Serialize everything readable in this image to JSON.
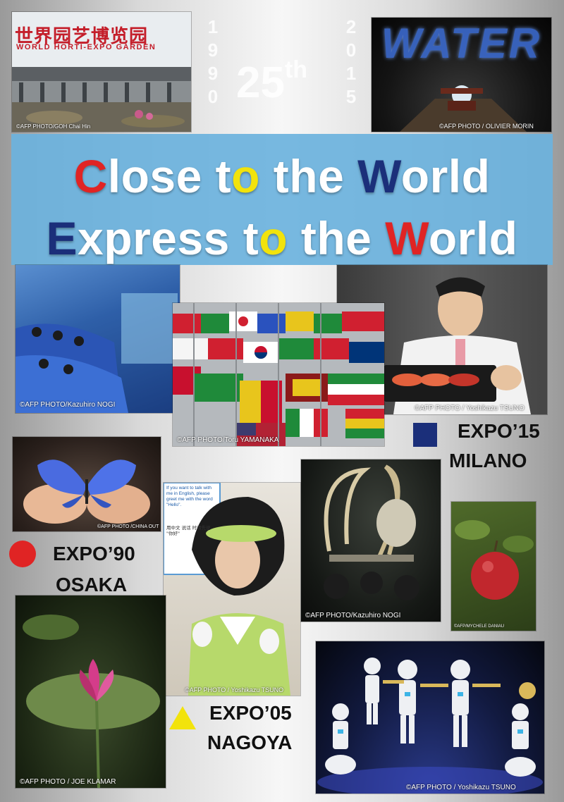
{
  "years": {
    "left": [
      "1",
      "9",
      "9",
      "0"
    ],
    "right": [
      "2",
      "0",
      "1",
      "5"
    ],
    "anniversary_number": "25",
    "anniversary_suffix": "th"
  },
  "headline": {
    "line1": [
      {
        "text": "C",
        "color": "#e02424"
      },
      {
        "text": "lose t",
        "color": "#ffffff"
      },
      {
        "text": "o",
        "color": "#f2e30c"
      },
      {
        "text": " the ",
        "color": "#ffffff"
      },
      {
        "text": "W",
        "color": "#1b2f7a"
      },
      {
        "text": "orld",
        "color": "#ffffff"
      }
    ],
    "line2": [
      {
        "text": "E",
        "color": "#1b2f7a"
      },
      {
        "text": "xpress t",
        "color": "#ffffff"
      },
      {
        "text": "o",
        "color": "#f2e30c"
      },
      {
        "text": " the ",
        "color": "#ffffff"
      },
      {
        "text": "W",
        "color": "#e02424"
      },
      {
        "text": "orld",
        "color": "#ffffff"
      }
    ]
  },
  "photos": {
    "garden": {
      "sign_cn": "世界园艺博览园",
      "sign_en": "WORLD HORTI-EXPO GARDEN",
      "credit": "©AFP PHOTO/GOH Chai Hin"
    },
    "water": {
      "title": "WATER",
      "credit": "©AFP PHOTO / OLIVIER MORIN"
    },
    "theater": {
      "credit": "©AFP PHOTO/Kazuhiro NOGI"
    },
    "flags": {
      "credit": "©AFP PHOTO/Toru YAMANAKA"
    },
    "sushi": {
      "credit": "©AFP PHOTO / Yoshikazu TSUNO"
    },
    "butterfly": {
      "credit": "©AFP PHOTO /CHINA OUT"
    },
    "robot_guide": {
      "sign_text": "If you want to talk with me in English, please greet me with the word \"Hello\".",
      "sign_cn": "用中文 说话 时请先说 \"你好\"",
      "credit": "©AFP PHOTO / Yoshikazu TSUNO"
    },
    "mammoth": {
      "credit": "©AFP PHOTO/Kazuhiro NOGI"
    },
    "apple": {
      "credit": "©AFP/MYCHELE DANIAU"
    },
    "lotus": {
      "credit": "©AFP PHOTO / JOE KLAMAR"
    },
    "robot_band": {
      "credit": "©AFP PHOTO / Yoshikazu TSUNO"
    }
  },
  "expos": {
    "milano": {
      "line1": "EXPO’15",
      "line2": "MILANO",
      "marker_color": "#1b2f7a",
      "marker": "square"
    },
    "osaka": {
      "line1": "EXPO’90",
      "line2": "OSAKA",
      "marker_color": "#e02424",
      "marker": "circle"
    },
    "nagoya": {
      "line1": "EXPO’05",
      "line2": "NAGOYA",
      "marker_color": "#f2e30c",
      "marker": "triangle"
    }
  }
}
